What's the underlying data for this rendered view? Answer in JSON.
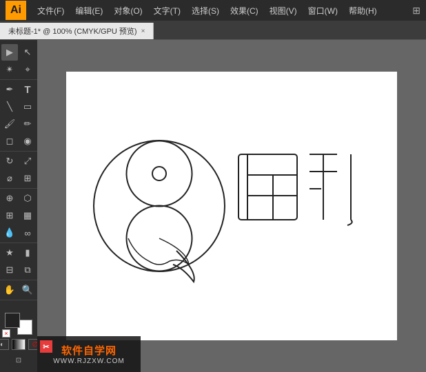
{
  "titlebar": {
    "logo": "Ai",
    "menus": [
      "文件(F)",
      "编辑(E)",
      "对象(O)",
      "文字(T)",
      "选择(S)",
      "效果(C)",
      "视图(V)",
      "窗口(W)",
      "帮助(H)"
    ]
  },
  "tabs": [
    {
      "label": "未标题-1* @ 100% (CMYK/GPU 预览)",
      "close": "×"
    }
  ],
  "toolbar": {
    "tools": [
      {
        "name": "selection",
        "icon": "▶"
      },
      {
        "name": "direct-selection",
        "icon": "↖"
      },
      {
        "name": "magic-wand",
        "icon": "✴"
      },
      {
        "name": "lasso",
        "icon": "⌖"
      },
      {
        "name": "pen",
        "icon": "✒"
      },
      {
        "name": "add-anchor",
        "icon": "+"
      },
      {
        "name": "remove-anchor",
        "icon": "-"
      },
      {
        "name": "type",
        "icon": "T"
      },
      {
        "name": "line",
        "icon": "╲"
      },
      {
        "name": "rect",
        "icon": "▭"
      },
      {
        "name": "ellipse",
        "icon": "○"
      },
      {
        "name": "paintbrush",
        "icon": "🖌"
      },
      {
        "name": "pencil",
        "icon": "✏"
      },
      {
        "name": "blob-brush",
        "icon": "◉"
      },
      {
        "name": "eraser",
        "icon": "◻"
      },
      {
        "name": "rotate",
        "icon": "↻"
      },
      {
        "name": "scale",
        "icon": "⤢"
      },
      {
        "name": "warp",
        "icon": "⌀"
      },
      {
        "name": "free-transform",
        "icon": "⊞"
      },
      {
        "name": "shape-builder",
        "icon": "⊕"
      },
      {
        "name": "perspective-grid",
        "icon": "⬡"
      },
      {
        "name": "mesh",
        "icon": "⊞"
      },
      {
        "name": "gradient",
        "icon": "▦"
      },
      {
        "name": "eyedropper",
        "icon": "💧"
      },
      {
        "name": "blend",
        "icon": "∞"
      },
      {
        "name": "symbol-sprayer",
        "icon": "★"
      },
      {
        "name": "column-graph",
        "icon": "▮"
      },
      {
        "name": "artboard",
        "icon": "⊟"
      },
      {
        "name": "slice",
        "icon": "⧉"
      },
      {
        "name": "hand",
        "icon": "✋"
      },
      {
        "name": "zoom",
        "icon": "🔍"
      }
    ]
  },
  "colors": {
    "front_fill": "#222222",
    "back_fill": "#ffffff",
    "stroke": "#000000"
  },
  "canvas": {
    "title": "未标题-1",
    "zoom": "100%",
    "mode": "CMYK/GPU 预览"
  },
  "watermark": {
    "line1": "软件自学网",
    "line2": "WWW.RJZXW.COM",
    "icon": "✂"
  }
}
